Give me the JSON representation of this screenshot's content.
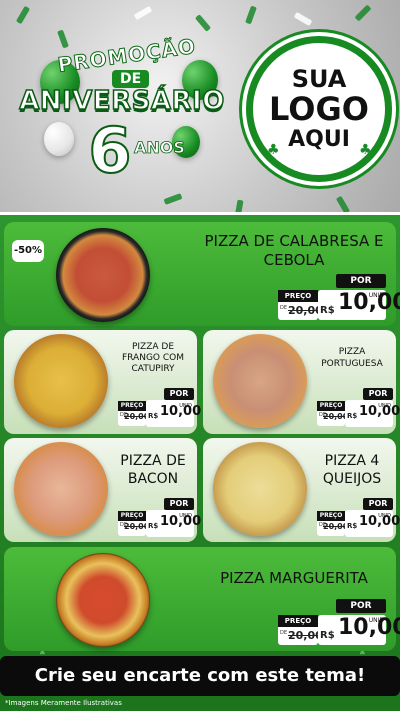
{
  "promo": {
    "top": "PROMOÇÃO",
    "de": "DE",
    "main": "ANIVERSÁRIO",
    "number": "6",
    "anos": "ANOS"
  },
  "logo": {
    "line1": "SUA",
    "line2": "LOGO",
    "line3": "AQUI"
  },
  "price_tag": {
    "por": "POR",
    "preco": "PREÇO",
    "de": "DE",
    "currency": "R$",
    "unit": "UNID"
  },
  "items": [
    {
      "name": "PIZZA DE CALABRESA E CEBOLA",
      "badge": "-50%",
      "old_price": "20,00",
      "price": "10,00"
    },
    {
      "name": "PIZZA DE FRANGO COM CATUPIRY",
      "old_price": "20,00",
      "price": "10,00"
    },
    {
      "name": "PIZZA PORTUGUESA",
      "old_price": "20,00",
      "price": "10,00"
    },
    {
      "name": "PIZZA DE BACON",
      "old_price": "20,00",
      "price": "10,00"
    },
    {
      "name": "PIZZA 4 QUEIJOS",
      "old_price": "20,00",
      "price": "10,00"
    },
    {
      "name": "PIZZA MARGUERITA",
      "old_price": "20,00",
      "price": "10,00"
    }
  ],
  "banner": "Crie seu encarte com este tema!",
  "footnote": "*Imagens Meramente Ilustrativas",
  "colors": {
    "primary_green": "#2e962e",
    "dark_green": "#178a22",
    "light_card": "#e8f3e0",
    "black": "#111111"
  }
}
